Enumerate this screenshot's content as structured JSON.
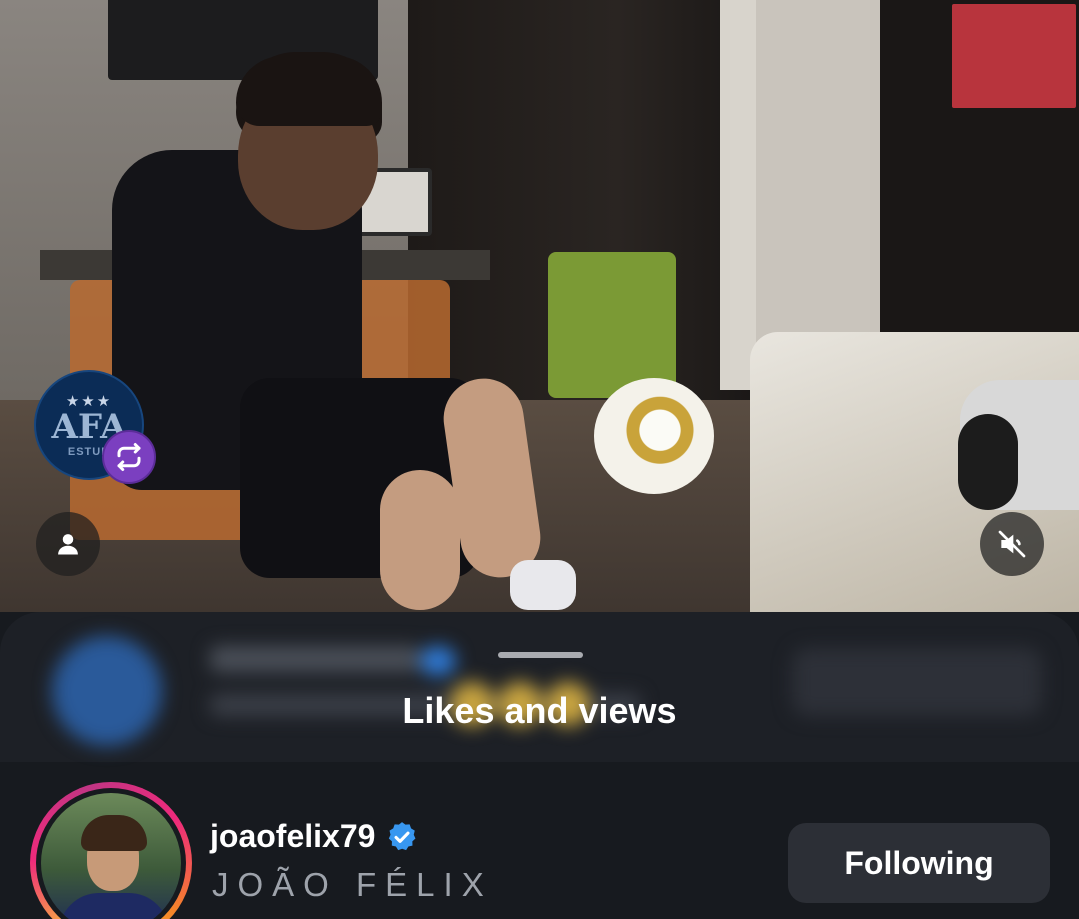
{
  "video": {
    "account_logo": {
      "stars": "★★★",
      "text": "AFA",
      "subtext": "ESTUD"
    },
    "icons": {
      "repost": "repost-icon",
      "user": "person-icon",
      "mute": "speaker-muted-icon"
    },
    "colors": {
      "repost_badge": "#7b3fc0"
    }
  },
  "sheet": {
    "title": "Likes and views",
    "blurred_row": {
      "button_label": "Following"
    },
    "rows": [
      {
        "username": "joaofelix79",
        "verified": true,
        "full_name": "JOÃO FÉLIX",
        "action_label": "Following"
      }
    ]
  },
  "colors": {
    "verified_badge": "#3897f0",
    "sheet_background": "#171a1f",
    "button_background": "#2c2f36"
  }
}
